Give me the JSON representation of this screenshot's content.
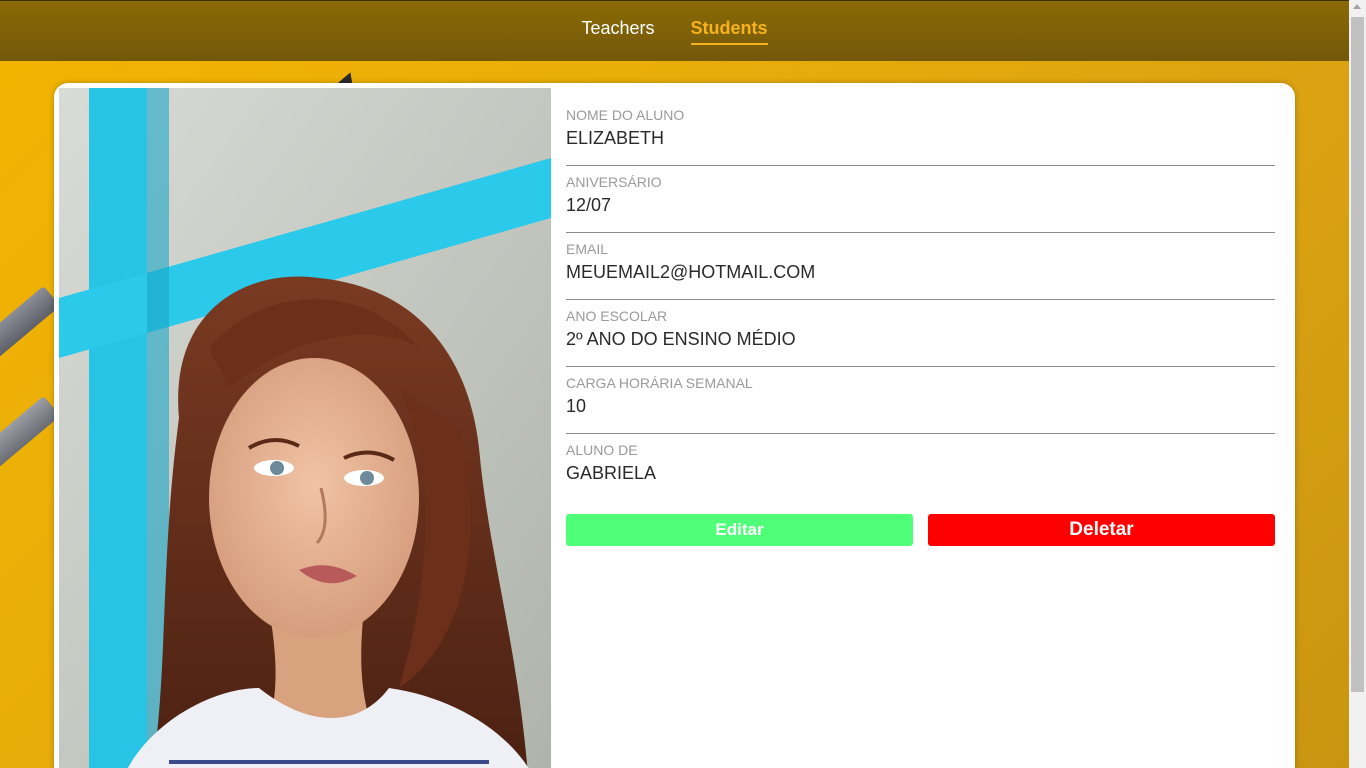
{
  "nav": {
    "items": [
      {
        "label": "Teachers",
        "active": false
      },
      {
        "label": "Students",
        "active": true
      }
    ]
  },
  "student": {
    "photo": "student-portrait",
    "fields": [
      {
        "label": "NOME DO ALUNO",
        "value": "ELIZABETH"
      },
      {
        "label": "ANIVERSÁRIO",
        "value": "12/07"
      },
      {
        "label": "EMAIL",
        "value": "MEUEMAIL2@HOTMAIL.COM"
      },
      {
        "label": "ANO ESCOLAR",
        "value": "2º ANO DO ENSINO MÉDIO"
      },
      {
        "label": "CARGA HORÁRIA SEMANAL",
        "value": "10"
      },
      {
        "label": "ALUNO DE",
        "value": "GABRIELA"
      }
    ]
  },
  "actions": {
    "edit_label": "Editar",
    "delete_label": "Deletar"
  },
  "colors": {
    "accent": "#f5b21c",
    "topbar": "#7c5f07",
    "edit": "#4fff78",
    "delete": "#ff0000"
  }
}
